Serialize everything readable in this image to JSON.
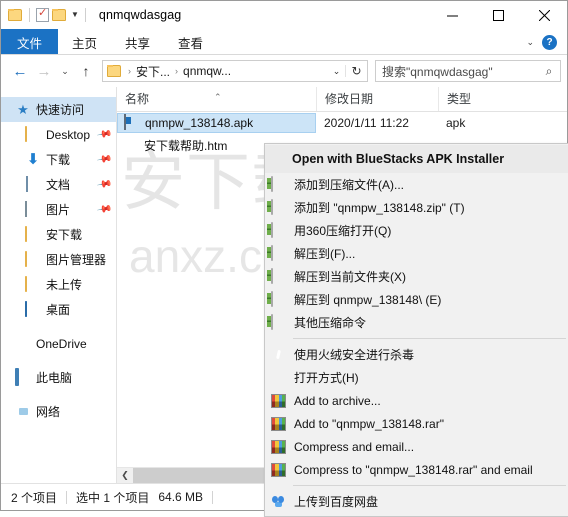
{
  "window": {
    "title": "qnmqwdasgag",
    "quick_access_icons": [
      "folder-icon",
      "properties-icon",
      "new-folder-icon",
      "customize-chevron-icon"
    ],
    "controls": {
      "minimize": "minimize-icon",
      "maximize": "maximize-icon",
      "close": "close-icon"
    }
  },
  "ribbon": {
    "tabs": [
      {
        "label": "文件",
        "active": true
      },
      {
        "label": "主页",
        "active": false
      },
      {
        "label": "共享",
        "active": false
      },
      {
        "label": "查看",
        "active": false
      }
    ],
    "collapse_icon": "chevron-down-icon",
    "help_label": "?"
  },
  "address": {
    "back_icon": "arrow-left-icon",
    "forward_icon": "arrow-right-icon",
    "recent_icon": "chevron-down-icon",
    "up_icon": "arrow-up-icon",
    "crumbs": [
      "安下...",
      "qnmqw..."
    ],
    "crumb_separator": "›",
    "dropdown_icon": "chevron-down-icon",
    "refresh_icon": "refresh-icon",
    "refresh_glyph": "↻"
  },
  "search": {
    "value": "搜索\"qnmqwdasgag\"",
    "placeholder": "搜索\"qnmqwdasgag\"",
    "icon": "search-icon"
  },
  "sidebar": {
    "items": [
      {
        "label": "快速访问",
        "icon": "star-icon",
        "selected": true,
        "pinned": false,
        "indent": false
      },
      {
        "label": "Desktop",
        "icon": "folder-icon",
        "selected": false,
        "pinned": true,
        "indent": true
      },
      {
        "label": "下载",
        "icon": "download-icon",
        "selected": false,
        "pinned": true,
        "indent": true
      },
      {
        "label": "文档",
        "icon": "document-icon",
        "selected": false,
        "pinned": true,
        "indent": true
      },
      {
        "label": "图片",
        "icon": "pictures-icon",
        "selected": false,
        "pinned": true,
        "indent": true
      },
      {
        "label": "安下载",
        "icon": "folder-icon",
        "selected": false,
        "pinned": false,
        "indent": true
      },
      {
        "label": "图片管理器",
        "icon": "folder-icon",
        "selected": false,
        "pinned": false,
        "indent": true
      },
      {
        "label": "未上传",
        "icon": "folder-icon",
        "selected": false,
        "pinned": false,
        "indent": true
      },
      {
        "label": "桌面",
        "icon": "desktop-icon",
        "selected": false,
        "pinned": false,
        "indent": true
      },
      {
        "label": "OneDrive",
        "icon": "onedrive-icon",
        "selected": false,
        "pinned": false,
        "indent": false
      },
      {
        "label": "此电脑",
        "icon": "this-pc-icon",
        "selected": false,
        "pinned": false,
        "indent": false
      },
      {
        "label": "网络",
        "icon": "network-icon",
        "selected": false,
        "pinned": false,
        "indent": false
      }
    ]
  },
  "file_list": {
    "columns": [
      {
        "label": "名称",
        "sorted": true,
        "sort_icon": "sort-ascending-icon"
      },
      {
        "label": "修改日期",
        "sorted": false
      },
      {
        "label": "类型",
        "sorted": false
      }
    ],
    "rows": [
      {
        "name": "qnmpw_138148.apk",
        "date": "2020/1/11 11:22",
        "type": "apk",
        "icon": "apk-file-icon",
        "selected": true
      },
      {
        "name": "安下载帮助.htm",
        "date": "",
        "type": "",
        "icon": "html-file-icon",
        "selected": false
      }
    ]
  },
  "context_menu": {
    "header": "Open with BlueStacks APK Installer",
    "groups": [
      [
        {
          "label": "添加到压缩文件(A)...",
          "icon": "360zip-icon"
        },
        {
          "label": "添加到 \"qnmpw_138148.zip\" (T)",
          "icon": "360zip-icon"
        },
        {
          "label": "用360压缩打开(Q)",
          "icon": "360zip-icon"
        },
        {
          "label": "解压到(F)...",
          "icon": "360zip-icon"
        },
        {
          "label": "解压到当前文件夹(X)",
          "icon": "360zip-icon"
        },
        {
          "label": "解压到 qnmpw_138148\\ (E)",
          "icon": "360zip-icon"
        },
        {
          "label": "其他压缩命令",
          "icon": "360zip-icon"
        }
      ],
      [
        {
          "label": "使用火绒安全进行杀毒",
          "icon": "huorong-shield-icon"
        },
        {
          "label": "打开方式(H)",
          "icon": "none"
        },
        {
          "label": "Add to archive...",
          "icon": "winrar-icon"
        },
        {
          "label": "Add to \"qnmpw_138148.rar\"",
          "icon": "winrar-icon"
        },
        {
          "label": "Compress and email...",
          "icon": "winrar-icon"
        },
        {
          "label": "Compress to \"qnmpw_138148.rar\" and email",
          "icon": "winrar-icon"
        }
      ],
      [
        {
          "label": "上传到百度网盘",
          "icon": "baidu-netdisk-icon"
        }
      ]
    ]
  },
  "scrollbar": {
    "left_arrow": "chevron-left-icon"
  },
  "status": {
    "item_count": "2 个项目",
    "selection": "选中 1 个项目",
    "size": "64.6 MB"
  },
  "watermark": {
    "text1": "安下载",
    "text2": "anxz.com"
  },
  "colors": {
    "accent": "#1b72c4",
    "selection": "#cce4f7",
    "folder": "#fcd77f"
  }
}
